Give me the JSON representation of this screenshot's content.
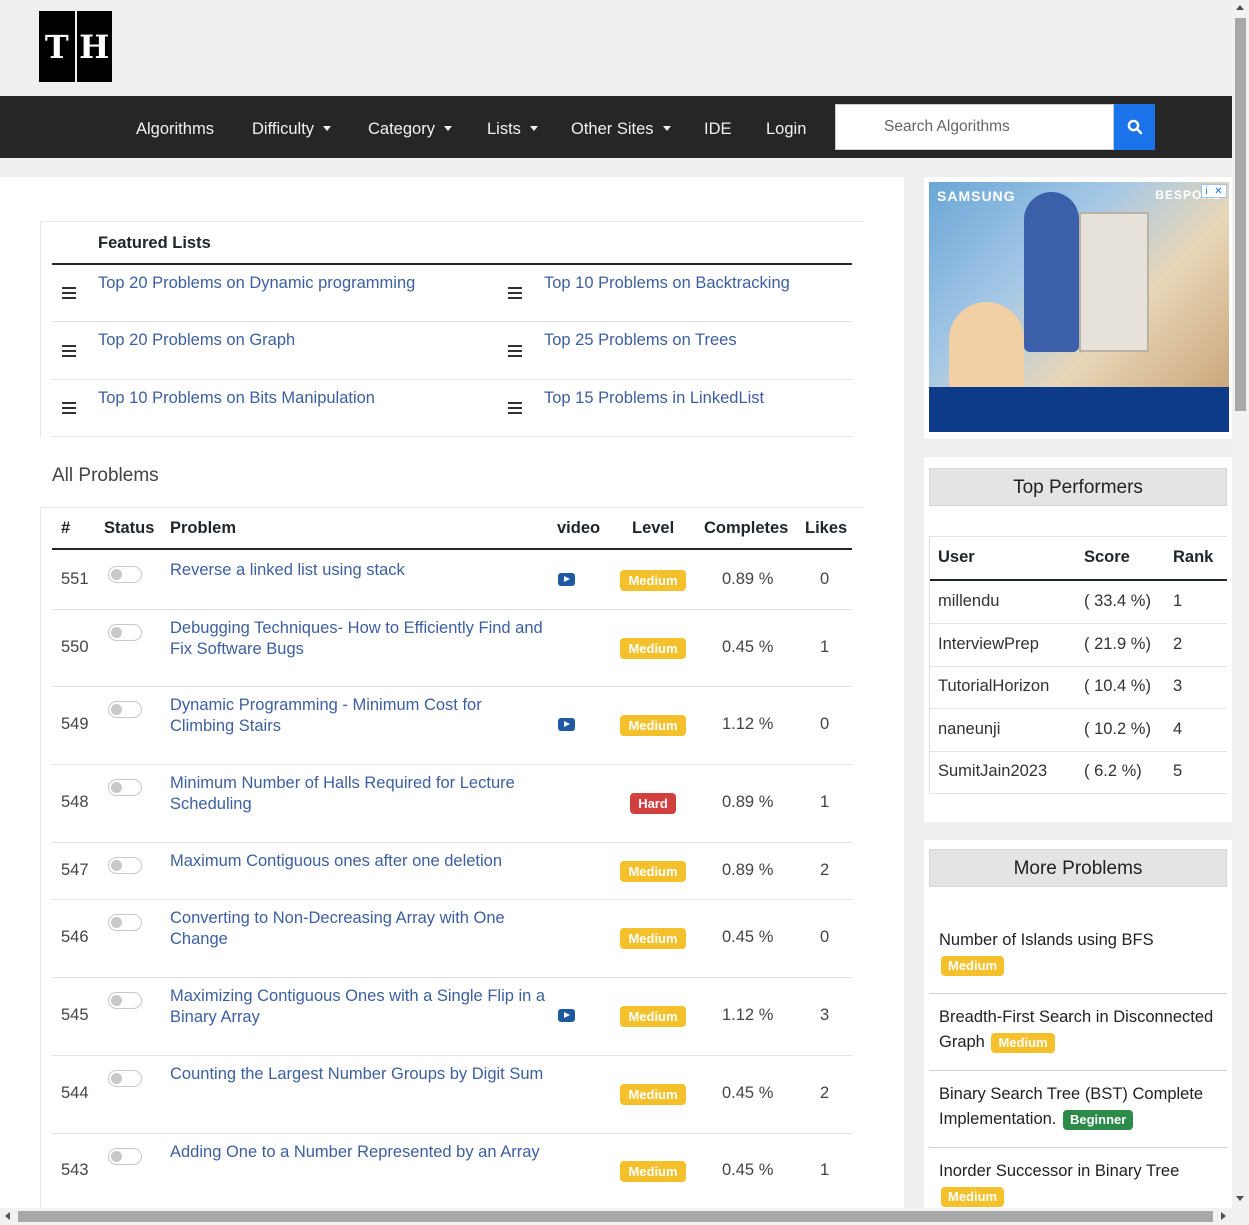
{
  "logo": {
    "letter1": "T",
    "letter2": "H"
  },
  "nav": {
    "items": [
      {
        "label": "Algorithms",
        "dropdown": false
      },
      {
        "label": "Difficulty",
        "dropdown": true
      },
      {
        "label": "Category",
        "dropdown": true
      },
      {
        "label": "Lists",
        "dropdown": true
      },
      {
        "label": "Other Sites",
        "dropdown": true
      },
      {
        "label": "IDE",
        "dropdown": false
      },
      {
        "label": "Login",
        "dropdown": false
      }
    ],
    "search_placeholder": "Search Algorithms",
    "search_icon": "search-icon"
  },
  "featured": {
    "title": "Featured Lists",
    "lists": [
      "Top 20 Problems on Dynamic programming",
      "Top 10 Problems on Backtracking",
      "Top 20 Problems on Graph",
      "Top 25 Problems on Trees",
      "Top 10 Problems on Bits Manipulation",
      "Top 15 Problems in LinkedList"
    ]
  },
  "problems": {
    "title": "All Problems",
    "columns": [
      "#",
      "Status",
      "Problem",
      "video",
      "Level",
      "Completes",
      "Likes"
    ],
    "rows": [
      {
        "id": "551",
        "title": "Reverse a linked list using stack",
        "video": true,
        "level": "Medium",
        "completes": "0.89 %",
        "likes": "0"
      },
      {
        "id": "550",
        "title": "Debugging Techniques- How to Efficiently Find and Fix Software Bugs",
        "video": false,
        "level": "Medium",
        "completes": "0.45 %",
        "likes": "1"
      },
      {
        "id": "549",
        "title": "Dynamic Programming - Minimum Cost for Climbing Stairs",
        "video": true,
        "level": "Medium",
        "completes": "1.12 %",
        "likes": "0"
      },
      {
        "id": "548",
        "title": "Minimum Number of Halls Required for Lecture Scheduling",
        "video": false,
        "level": "Hard",
        "completes": "0.89 %",
        "likes": "1"
      },
      {
        "id": "547",
        "title": "Maximum Contiguous ones after one deletion",
        "video": false,
        "level": "Medium",
        "completes": "0.89 %",
        "likes": "2"
      },
      {
        "id": "546",
        "title": "Converting to Non-Decreasing Array with One Change",
        "video": false,
        "level": "Medium",
        "completes": "0.45 %",
        "likes": "0"
      },
      {
        "id": "545",
        "title": "Maximizing Contiguous Ones with a Single Flip in a Binary Array",
        "video": true,
        "level": "Medium",
        "completes": "1.12 %",
        "likes": "3"
      },
      {
        "id": "544",
        "title": "Counting the Largest Number Groups by Digit Sum",
        "video": false,
        "level": "Medium",
        "completes": "0.45 %",
        "likes": "2"
      },
      {
        "id": "543",
        "title": "Adding One to a Number Represented by an Array",
        "video": false,
        "level": "Medium",
        "completes": "0.45 %",
        "likes": "1"
      }
    ]
  },
  "ad": {
    "brand": "SAMSUNG",
    "product": "BESPOKE"
  },
  "top_performers": {
    "title": "Top Performers",
    "columns": [
      "User",
      "Score",
      "Rank"
    ],
    "rows": [
      {
        "user": "millendu",
        "score": "( 33.4 %)",
        "rank": "1"
      },
      {
        "user": "InterviewPrep",
        "score": "( 21.9 %)",
        "rank": "2"
      },
      {
        "user": "TutorialHorizon",
        "score": "( 10.4 %)",
        "rank": "3"
      },
      {
        "user": "naneunji",
        "score": "( 10.2 %)",
        "rank": "4"
      },
      {
        "user": "SumitJain2023",
        "score": "( 6.2 %)",
        "rank": "5"
      }
    ]
  },
  "more_problems": {
    "title": "More Problems",
    "items": [
      {
        "title": "Number of Islands using BFS",
        "level": "Medium"
      },
      {
        "title": "Breadth-First Search in Disconnected Graph",
        "level": "Medium"
      },
      {
        "title": "Binary Search Tree (BST) Complete Implementation.",
        "level": "Beginner"
      },
      {
        "title": "Inorder Successor in Binary Tree",
        "level": "Medium"
      }
    ]
  },
  "colors": {
    "nav_bg": "#262626",
    "link": "#3d5fa0",
    "medium": "#f4c02c",
    "hard": "#d23f3f",
    "beginner": "#2c8a4a",
    "search_button": "#1a73e8"
  }
}
